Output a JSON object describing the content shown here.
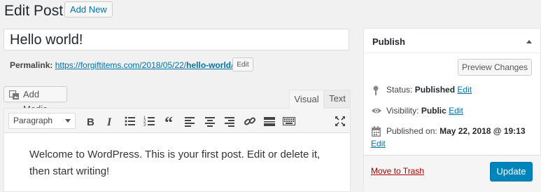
{
  "header": {
    "title": "Edit Post",
    "add_new_label": "Add New"
  },
  "post": {
    "title": "Hello world!",
    "permalink_label": "Permalink:",
    "permalink_base": "https://forgiftitems.com/2018/05/22/",
    "permalink_slug": "hello-world",
    "permalink_trail": "/",
    "permalink_edit_label": "Edit"
  },
  "editor": {
    "add_media_label": "Add Media",
    "tabs": [
      {
        "label": "Visual",
        "active": true
      },
      {
        "label": "Text",
        "active": false
      }
    ],
    "format_selected": "Paragraph",
    "toolbar_icons": [
      "bold-icon",
      "italic-icon",
      "bulleted-list-icon",
      "numbered-list-icon",
      "blockquote-icon",
      "align-left-icon",
      "align-center-icon",
      "align-right-icon",
      "insert-link-icon",
      "read-more-icon",
      "toolbar-toggle-icon",
      "fullscreen-icon"
    ],
    "content": "Welcome to WordPress. This is your first post. Edit or delete it, then start writing!"
  },
  "publish": {
    "title": "Publish",
    "preview_label": "Preview Changes",
    "status_label": "Status:",
    "status_value": "Published",
    "visibility_label": "Visibility:",
    "visibility_value": "Public",
    "published_label": "Published on:",
    "published_value": "May 22, 2018 @ 19:13",
    "edit_label": "Edit",
    "trash_label": "Move to Trash",
    "update_label": "Update"
  },
  "colors": {
    "link": "#0073aa",
    "primary_button": "#0085ba",
    "trash": "#a00"
  }
}
